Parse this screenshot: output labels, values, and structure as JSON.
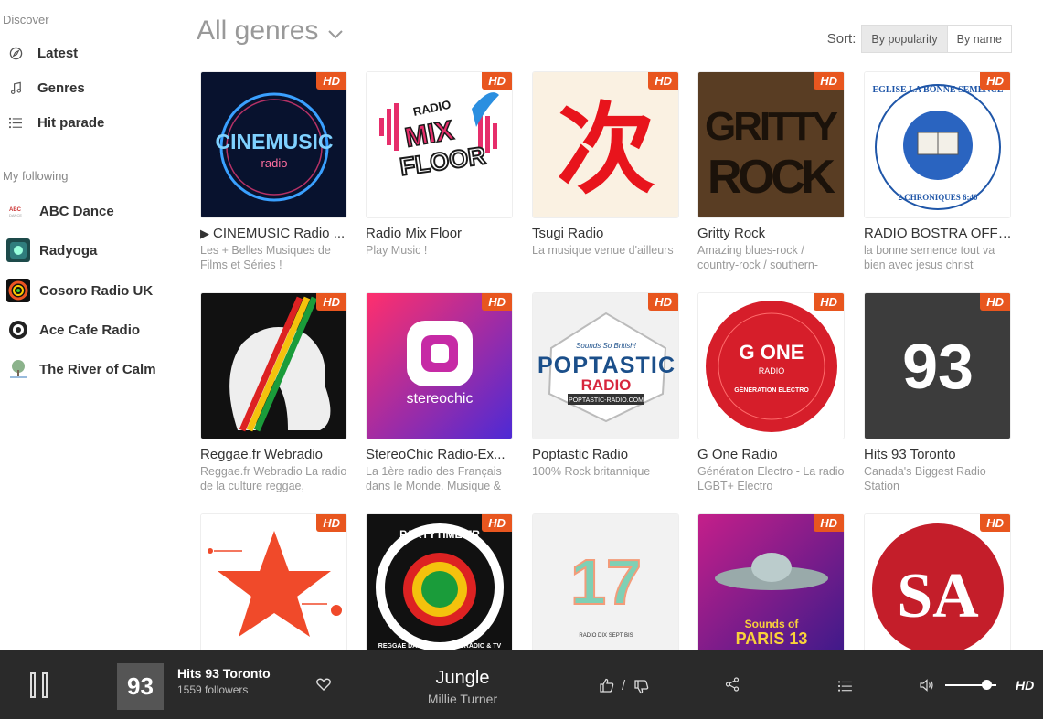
{
  "sidebar": {
    "discover_label": "Discover",
    "nav": [
      {
        "label": "Latest",
        "icon": "compass-icon"
      },
      {
        "label": "Genres",
        "icon": "music-note-icon"
      },
      {
        "label": "Hit parade",
        "icon": "list-icon"
      }
    ],
    "following_label": "My following",
    "following": [
      {
        "label": "ABC Dance"
      },
      {
        "label": "Radyoga"
      },
      {
        "label": "Cosoro Radio UK"
      },
      {
        "label": "Ace Cafe Radio"
      },
      {
        "label": "The River of Calm"
      }
    ]
  },
  "header": {
    "genre_title": "All genres",
    "sort_label": "Sort:",
    "sort_options": [
      "By popularity",
      "By name"
    ],
    "sort_active": "By popularity"
  },
  "stations": [
    {
      "title": "CINEMUSIC Radio ...",
      "desc": "Les + Belles Musiques de Films et Séries !",
      "hd": "HD",
      "playing_marker": true,
      "art_text": [
        "CINEMUSIC",
        "radio"
      ]
    },
    {
      "title": "Radio Mix Floor",
      "desc": "Play Music !",
      "hd": "HD",
      "art_text": [
        "RADIO",
        "MIX",
        "FLOOR"
      ]
    },
    {
      "title": "Tsugi Radio",
      "desc": "La musique venue d'ailleurs",
      "hd": "HD",
      "art_text": [
        "次"
      ]
    },
    {
      "title": "Gritty Rock",
      "desc": "Amazing blues-rock / country-rock / southern-",
      "hd": "HD",
      "art_text": [
        "GRITTY",
        "ROCK"
      ]
    },
    {
      "title": "RADIO BOSTRA OFFI...",
      "desc": "la bonne semence tout va bien avec jesus christ",
      "hd": "HD",
      "art_text": [
        "EGLISE LA BONNE SEMENCE",
        "2 CHRONIQUES 6:40"
      ]
    },
    {
      "title": "Reggae.fr Webradio",
      "desc": "Reggae.fr Webradio La radio de la culture reggae,",
      "hd": "HD",
      "art_text": []
    },
    {
      "title": "StereoChic Radio-Ex...",
      "desc": "La 1ère radio des Français dans le Monde. Musique &",
      "hd": "HD",
      "art_text": [
        "stereochic"
      ]
    },
    {
      "title": "Poptastic Radio",
      "desc": "100% Rock britannique",
      "hd": "HD",
      "art_text": [
        "Sounds So British!",
        "POPTASTIC",
        "RADIO",
        "POPTASTIC-RADIO.COM"
      ]
    },
    {
      "title": "G One Radio",
      "desc": "Génération Electro - La radio LGBT+ Electro",
      "hd": "HD",
      "art_text": [
        "G ONE",
        "RADIO",
        "GÉNÉRATION ELECTRO"
      ]
    },
    {
      "title": "Hits 93 Toronto",
      "desc": "Canada's Biggest Radio Station",
      "hd": "HD",
      "art_text": [
        "93"
      ]
    },
    {
      "title": "",
      "desc": "",
      "hd": "HD",
      "art_text": []
    },
    {
      "title": "",
      "desc": "",
      "hd": "HD",
      "art_text": [
        "PARTYTIME.FR",
        "REGGAE DANCEHALL WEBRADIO & TV"
      ]
    },
    {
      "title": "",
      "desc": "",
      "hd": "",
      "art_text": [
        "17",
        "RADIO DIX SEPT BIS"
      ]
    },
    {
      "title": "",
      "desc": "",
      "hd": "HD",
      "art_text": [
        "Sounds of",
        "PARIS 13"
      ]
    },
    {
      "title": "",
      "desc": "",
      "hd": "HD",
      "art_text": [
        "SA"
      ]
    }
  ],
  "player": {
    "station": "Hits 93 Toronto",
    "followers": "1559 followers",
    "thumb_text": "93",
    "song": "Jungle",
    "artist": "Millie Turner",
    "vote_separator": "/",
    "volume": 0.75,
    "hd_label": "HD"
  }
}
